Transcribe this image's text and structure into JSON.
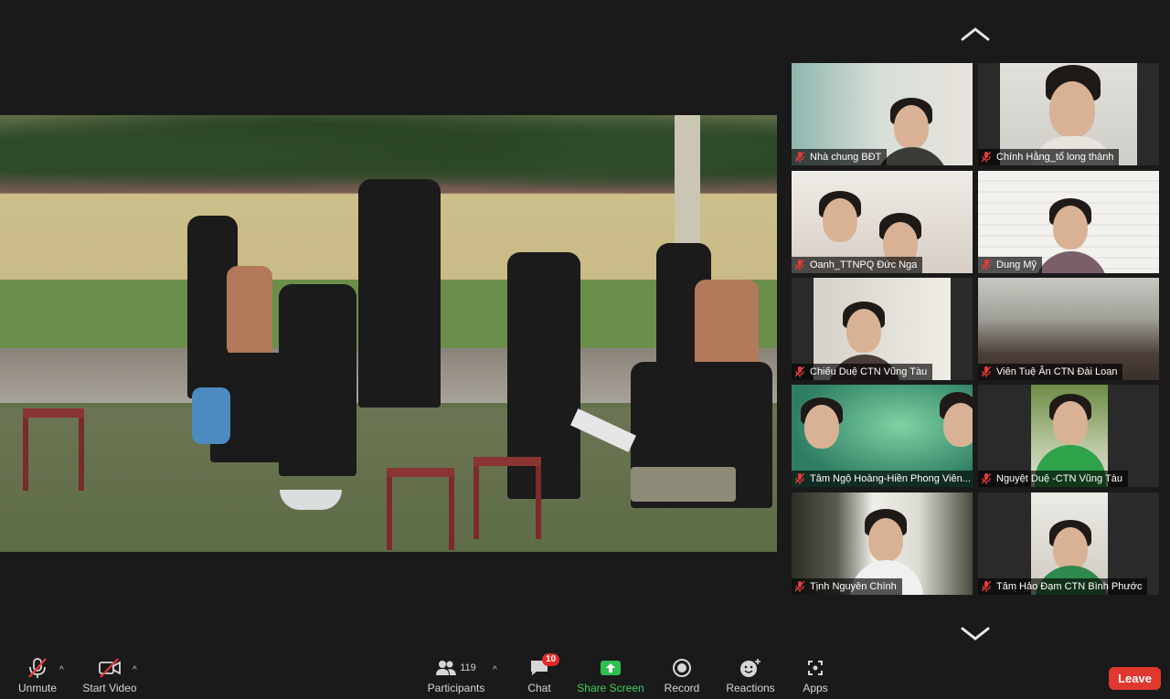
{
  "participants": [
    {
      "name": "Nhà chung BĐT",
      "bg": "#cfd9d3"
    },
    {
      "name": "Chính Hằng_tổ long thành",
      "bg": "#d8d6d1"
    },
    {
      "name": "Oanh_TTNPQ Đức Nga",
      "bg": "#e8e4df"
    },
    {
      "name": "Dung Mỹ",
      "bg": "#ecebe8"
    },
    {
      "name": "Chiếu Duệ CTN Vũng Tàu",
      "bg": "#dcd8cf"
    },
    {
      "name": "Viên Tuệ Ân CTN Đài Loan",
      "bg": "#7f7d74"
    },
    {
      "name": "Tâm Ngộ Hoàng-Hiền Phong Viên...",
      "bg": "#4fa07a"
    },
    {
      "name": "Nguyệt Duệ -CTN Vũng Tàu",
      "bg": "#6d8b44"
    },
    {
      "name": "Tịnh Nguyên Chính",
      "bg": "#3a3a32"
    },
    {
      "name": "Tâm Hảo Đạm CTN Bình Phước",
      "bg": "#d9d5cc"
    }
  ],
  "toolbar": {
    "unmute": "Unmute",
    "start_video": "Start Video",
    "participants": "Participants",
    "participants_count": "119",
    "chat": "Chat",
    "chat_badge": "10",
    "share_screen": "Share Screen",
    "record": "Record",
    "reactions": "Reactions",
    "apps": "Apps",
    "leave": "Leave"
  },
  "colors": {
    "background": "#1a1a1a",
    "share_green": "#3fce5f",
    "leave_red": "#e0372f",
    "badge_red": "#e02828"
  }
}
